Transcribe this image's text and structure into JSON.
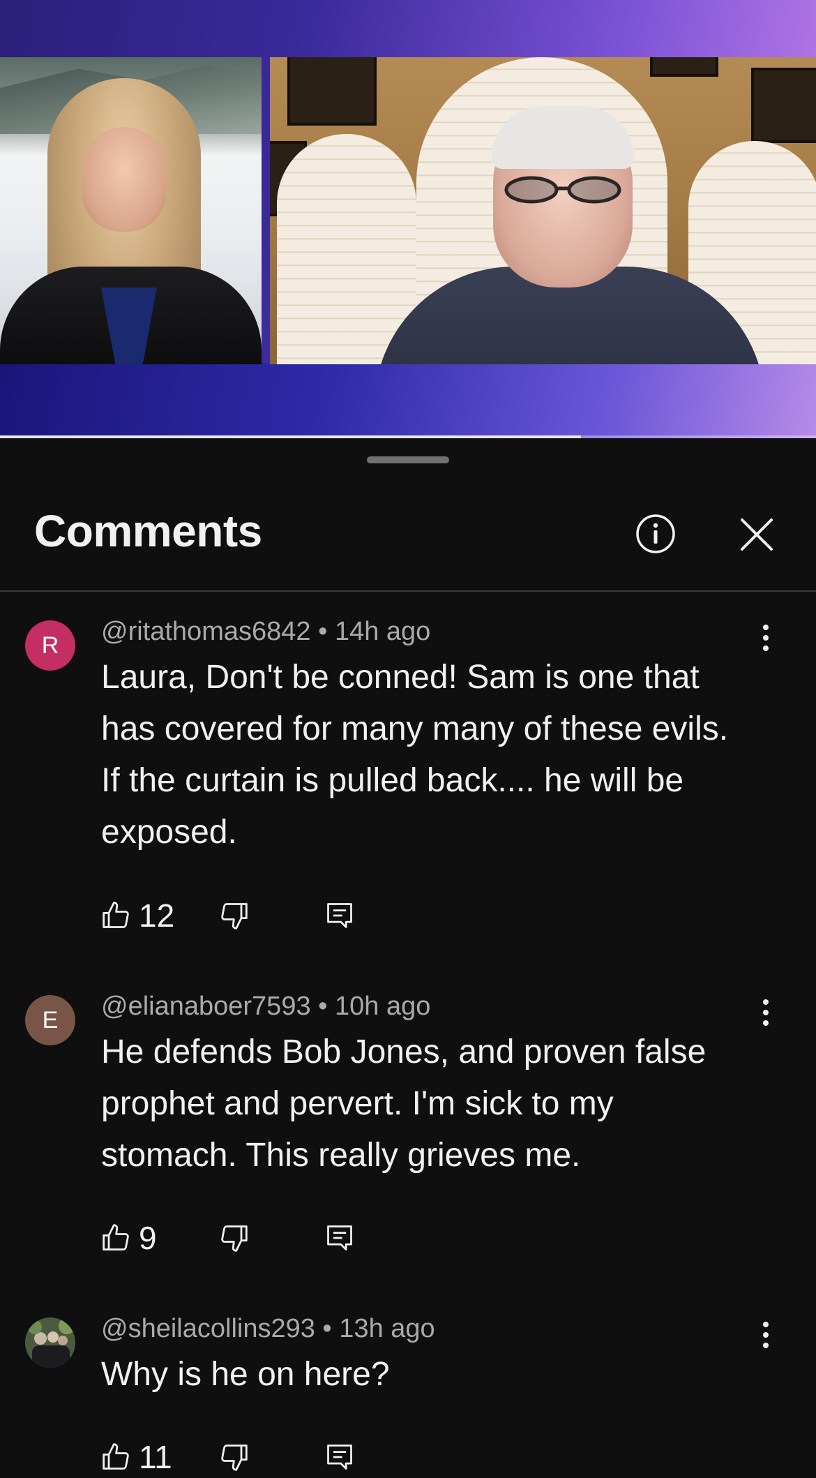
{
  "video": {
    "progress_fraction": 0.712
  },
  "sheet": {
    "title": "Comments",
    "info_icon": "info-icon",
    "close_icon": "close-icon"
  },
  "comments": [
    {
      "avatar_letter": "R",
      "avatar_color": "#c42e63",
      "handle": "@ritathomas6842",
      "time": "14h ago",
      "text": "Laura, Don't be conned!  Sam is one that has covered for many many of these evils.  If the curtain is pulled back.... he will be exposed.",
      "likes": "12"
    },
    {
      "avatar_letter": "E",
      "avatar_color": "#795548",
      "handle": "@elianaboer7593",
      "time": "10h ago",
      "text": "He defends Bob Jones, and proven false prophet and pervert.  I'm sick to my stomach.  This really grieves me.",
      "likes": "9"
    },
    {
      "avatar_letter": "",
      "avatar_color": "#3d4a36",
      "handle": "@sheilacollins293",
      "time": "13h ago",
      "text": "Why is he on here?",
      "likes": "11"
    }
  ],
  "separator": "•"
}
